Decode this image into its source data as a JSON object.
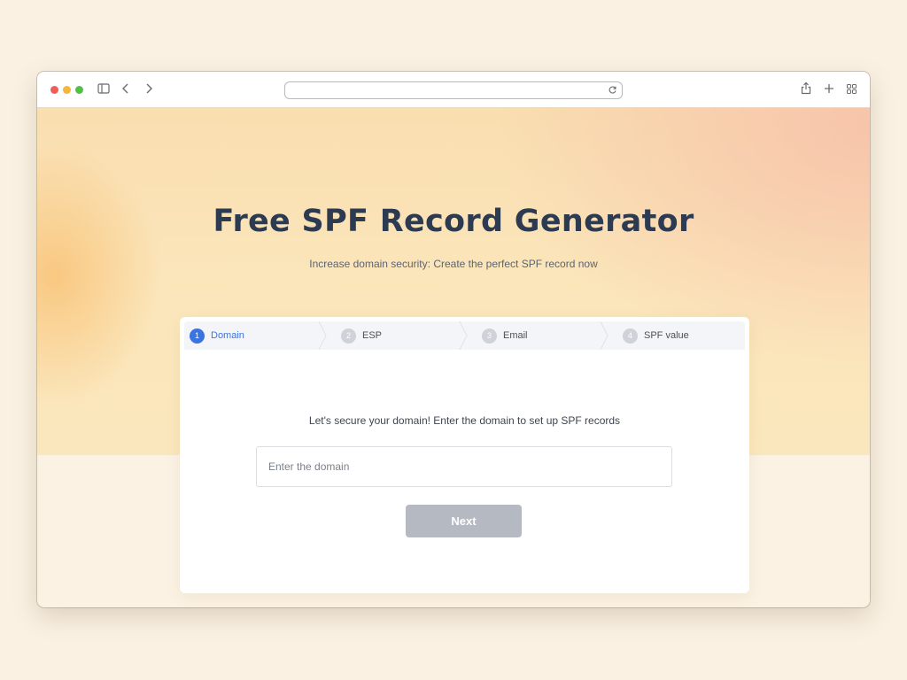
{
  "browser": {
    "url": "",
    "icons": [
      "sidebar-icon",
      "chevron-left-icon",
      "chevron-right-icon",
      "reload-icon",
      "share-icon",
      "plus-icon",
      "tabs-grid-icon"
    ]
  },
  "hero": {
    "title": "Free SPF Record Generator",
    "subtitle": "Increase domain security: Create the perfect SPF record now"
  },
  "steps": [
    {
      "number": "1",
      "label": "Domain",
      "active": true
    },
    {
      "number": "2",
      "label": "ESP",
      "active": false
    },
    {
      "number": "3",
      "label": "Email",
      "active": false
    },
    {
      "number": "4",
      "label": "SPF value",
      "active": false
    }
  ],
  "form": {
    "prompt": "Let's secure your domain! Enter the domain to set up SPF records",
    "domain_placeholder": "Enter the domain",
    "domain_value": "",
    "next_label": "Next"
  },
  "colors": {
    "title": "#2c3b52",
    "active_step": "#3b74e0",
    "button_disabled": "#b5b9c1"
  }
}
